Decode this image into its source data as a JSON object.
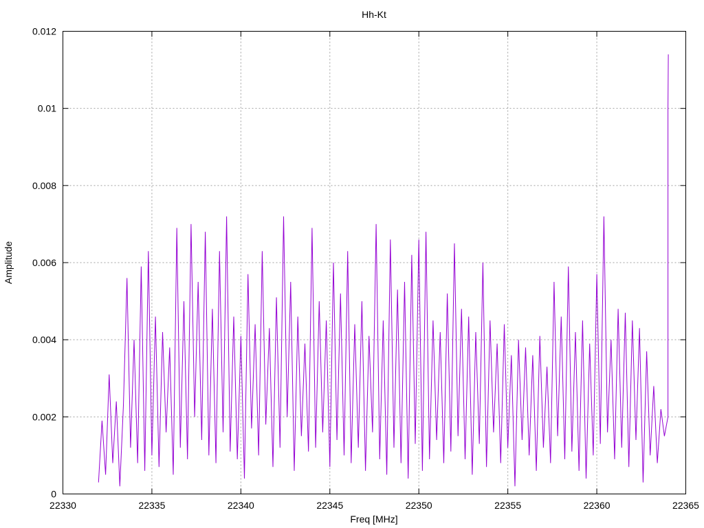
{
  "chart_data": {
    "type": "line",
    "title": "Hh-Kt",
    "xlabel": "Freq [MHz]",
    "ylabel": "Amplitude",
    "xlim": [
      22330,
      22365
    ],
    "ylim": [
      0,
      0.012
    ],
    "xticks": [
      "22330",
      "22335",
      "22340",
      "22345",
      "22350",
      "22355",
      "22360",
      "22365"
    ],
    "yticks": [
      "0",
      "0.002",
      "0.004",
      "0.006",
      "0.008",
      "0.01",
      "0.012"
    ],
    "grid": true,
    "legend": "none",
    "series": [
      {
        "name": "Hh-Kt",
        "color": "#9400d3",
        "x_start": 22332,
        "x_step": 0.2,
        "values": [
          0.0003,
          0.0019,
          0.0005,
          0.0031,
          0.0008,
          0.0024,
          0.0002,
          0.0023,
          0.0056,
          0.0012,
          0.004,
          0.0008,
          0.0059,
          0.0006,
          0.0063,
          0.001,
          0.0046,
          0.0007,
          0.0042,
          0.0016,
          0.0038,
          0.0005,
          0.0069,
          0.0012,
          0.005,
          0.0009,
          0.007,
          0.002,
          0.0055,
          0.0014,
          0.0068,
          0.001,
          0.0048,
          0.0008,
          0.0063,
          0.0016,
          0.0072,
          0.0011,
          0.0046,
          0.0009,
          0.0041,
          0.0004,
          0.0057,
          0.0017,
          0.0044,
          0.001,
          0.0063,
          0.0018,
          0.0043,
          0.0007,
          0.0051,
          0.0012,
          0.0072,
          0.002,
          0.0055,
          0.0006,
          0.0046,
          0.0015,
          0.0039,
          0.0011,
          0.0069,
          0.0012,
          0.005,
          0.0016,
          0.0045,
          0.0007,
          0.006,
          0.0014,
          0.0052,
          0.001,
          0.0063,
          0.0008,
          0.0044,
          0.0012,
          0.005,
          0.0006,
          0.0041,
          0.0016,
          0.007,
          0.0009,
          0.0045,
          0.0005,
          0.0066,
          0.0012,
          0.0053,
          0.0008,
          0.0055,
          0.0004,
          0.0062,
          0.0013,
          0.0066,
          0.0006,
          0.0068,
          0.0009,
          0.0045,
          0.0014,
          0.0042,
          0.0008,
          0.0052,
          0.0011,
          0.0065,
          0.0015,
          0.0048,
          0.0009,
          0.0046,
          0.0005,
          0.0042,
          0.0013,
          0.006,
          0.0007,
          0.0045,
          0.0016,
          0.0039,
          0.0008,
          0.0044,
          0.0012,
          0.0036,
          0.0002,
          0.004,
          0.0014,
          0.0038,
          0.001,
          0.0036,
          0.0006,
          0.0041,
          0.0012,
          0.0033,
          0.0008,
          0.0055,
          0.0015,
          0.0046,
          0.0009,
          0.0059,
          0.0011,
          0.0042,
          0.0006,
          0.0045,
          0.0004,
          0.0039,
          0.001,
          0.0057,
          0.0013,
          0.0072,
          0.0016,
          0.004,
          0.0009,
          0.0048,
          0.0012,
          0.0047,
          0.0007,
          0.0045,
          0.0014,
          0.0043,
          0.0003,
          0.0037,
          0.001,
          0.0028,
          0.0008,
          0.0022,
          0.0015,
          0.002
        ],
        "tail": [
          [
            22364.0,
            0.01
          ],
          [
            22364.02,
            0.0114
          ]
        ]
      }
    ]
  }
}
